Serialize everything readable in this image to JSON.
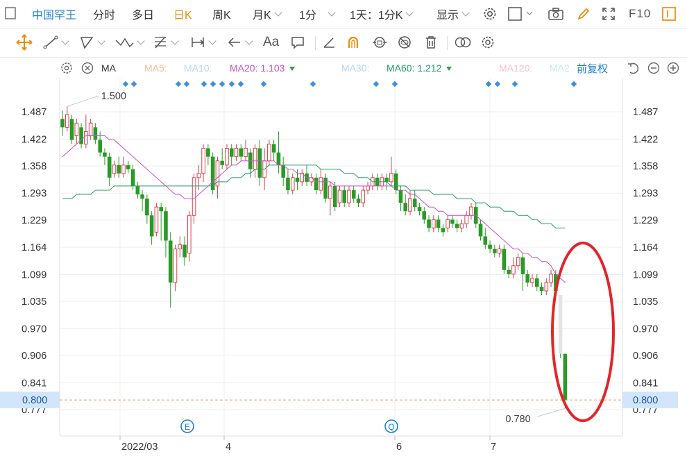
{
  "topbar": {
    "stock_name": "中国罕王",
    "tabs": [
      "分时",
      "多日",
      "日K",
      "周K",
      "月K"
    ],
    "active_tab": "日K",
    "period_select": "1分",
    "range_select": "1天：1分K",
    "display_select": "显示",
    "f10_label": "F10"
  },
  "toolbar": {
    "text_tool_label": "Aa"
  },
  "ma_bar": {
    "indicator": "MA",
    "ma5_label": "MA5:",
    "ma10_label": "MA10:",
    "ma20_label": "MA20:",
    "ma20_value": "1.103",
    "ma30_label": "MA30:",
    "ma60_label": "MA60:",
    "ma60_value": "1.212",
    "ma120_label": "MA120:",
    "ma250_label": "MA2",
    "adjust_label": "前复权"
  },
  "colors": {
    "up": "#d6404a",
    "down": "#2a9a26",
    "ma20": "#c94fc6",
    "ma60": "#219b6a",
    "accent_blue": "#1e7fd6",
    "active_orange": "#f08c00",
    "annotation_red": "#e0262b"
  },
  "chart_data": {
    "type": "candlestick",
    "y_ticks": [
      "1.487",
      "1.422",
      "1.358",
      "1.293",
      "1.229",
      "1.164",
      "1.099",
      "1.035",
      "0.970",
      "0.906",
      "0.841",
      "0.777"
    ],
    "ylim": [
      0.777,
      1.487
    ],
    "current_price": "0.800",
    "max_label": "1.500",
    "min_label": "0.780",
    "x_labels": [
      "2022/03",
      "4",
      "6",
      "7"
    ],
    "event_markers": [
      "E",
      "Q"
    ],
    "candles": [
      [
        1.47,
        1.45,
        1.49,
        1.43
      ],
      [
        1.45,
        1.48,
        1.5,
        1.44
      ],
      [
        1.47,
        1.42,
        1.48,
        1.41
      ],
      [
        1.43,
        1.46,
        1.47,
        1.41
      ],
      [
        1.45,
        1.41,
        1.46,
        1.4
      ],
      [
        1.41,
        1.44,
        1.48,
        1.4
      ],
      [
        1.43,
        1.46,
        1.47,
        1.42
      ],
      [
        1.45,
        1.42,
        1.46,
        1.41
      ],
      [
        1.42,
        1.39,
        1.44,
        1.38
      ],
      [
        1.39,
        1.38,
        1.4,
        1.36
      ],
      [
        1.38,
        1.33,
        1.39,
        1.31
      ],
      [
        1.34,
        1.36,
        1.37,
        1.33
      ],
      [
        1.36,
        1.34,
        1.38,
        1.33
      ],
      [
        1.34,
        1.36,
        1.38,
        1.33
      ],
      [
        1.36,
        1.35,
        1.37,
        1.34
      ],
      [
        1.35,
        1.31,
        1.36,
        1.3
      ],
      [
        1.31,
        1.29,
        1.32,
        1.28
      ],
      [
        1.29,
        1.28,
        1.3,
        1.25
      ],
      [
        1.28,
        1.24,
        1.29,
        1.22
      ],
      [
        1.24,
        1.19,
        1.25,
        1.17
      ],
      [
        1.2,
        1.26,
        1.27,
        1.19
      ],
      [
        1.26,
        1.25,
        1.27,
        1.18
      ],
      [
        1.25,
        1.18,
        1.26,
        1.14
      ],
      [
        1.18,
        1.08,
        1.2,
        1.02
      ],
      [
        1.08,
        1.16,
        1.17,
        1.06
      ],
      [
        1.16,
        1.17,
        1.19,
        1.14
      ],
      [
        1.17,
        1.14,
        1.19,
        1.12
      ],
      [
        1.15,
        1.24,
        1.25,
        1.13
      ],
      [
        1.24,
        1.33,
        1.34,
        1.22
      ],
      [
        1.33,
        1.34,
        1.36,
        1.3
      ],
      [
        1.34,
        1.4,
        1.41,
        1.32
      ],
      [
        1.4,
        1.38,
        1.41,
        1.36
      ],
      [
        1.38,
        1.3,
        1.39,
        1.29
      ],
      [
        1.31,
        1.37,
        1.38,
        1.28
      ],
      [
        1.37,
        1.36,
        1.4,
        1.35
      ],
      [
        1.36,
        1.4,
        1.41,
        1.35
      ],
      [
        1.4,
        1.38,
        1.41,
        1.36
      ],
      [
        1.38,
        1.4,
        1.41,
        1.37
      ],
      [
        1.4,
        1.38,
        1.41,
        1.37
      ],
      [
        1.38,
        1.4,
        1.42,
        1.37
      ],
      [
        1.39,
        1.35,
        1.4,
        1.33
      ],
      [
        1.35,
        1.4,
        1.41,
        1.33
      ],
      [
        1.4,
        1.33,
        1.42,
        1.31
      ],
      [
        1.33,
        1.37,
        1.4,
        1.3
      ],
      [
        1.37,
        1.41,
        1.42,
        1.36
      ],
      [
        1.41,
        1.39,
        1.42,
        1.37
      ],
      [
        1.39,
        1.36,
        1.44,
        1.34
      ],
      [
        1.36,
        1.33,
        1.38,
        1.31
      ],
      [
        1.33,
        1.3,
        1.35,
        1.29
      ],
      [
        1.3,
        1.33,
        1.34,
        1.29
      ],
      [
        1.33,
        1.32,
        1.35,
        1.3
      ],
      [
        1.32,
        1.34,
        1.35,
        1.31
      ],
      [
        1.34,
        1.32,
        1.36,
        1.31
      ],
      [
        1.32,
        1.33,
        1.34,
        1.31
      ],
      [
        1.33,
        1.3,
        1.34,
        1.29
      ],
      [
        1.3,
        1.33,
        1.35,
        1.29
      ],
      [
        1.33,
        1.28,
        1.34,
        1.27
      ],
      [
        1.28,
        1.31,
        1.32,
        1.24
      ],
      [
        1.31,
        1.26,
        1.32,
        1.25
      ],
      [
        1.27,
        1.3,
        1.31,
        1.26
      ],
      [
        1.3,
        1.27,
        1.31,
        1.26
      ],
      [
        1.27,
        1.3,
        1.31,
        1.26
      ],
      [
        1.3,
        1.28,
        1.31,
        1.27
      ],
      [
        1.28,
        1.27,
        1.29,
        1.26
      ],
      [
        1.27,
        1.3,
        1.31,
        1.26
      ],
      [
        1.3,
        1.31,
        1.32,
        1.29
      ],
      [
        1.31,
        1.33,
        1.34,
        1.3
      ],
      [
        1.33,
        1.31,
        1.34,
        1.3
      ],
      [
        1.31,
        1.33,
        1.34,
        1.3
      ],
      [
        1.33,
        1.32,
        1.34,
        1.3
      ],
      [
        1.32,
        1.34,
        1.38,
        1.31
      ],
      [
        1.34,
        1.3,
        1.35,
        1.29
      ],
      [
        1.3,
        1.27,
        1.31,
        1.25
      ],
      [
        1.27,
        1.25,
        1.29,
        1.24
      ],
      [
        1.25,
        1.28,
        1.3,
        1.24
      ],
      [
        1.28,
        1.26,
        1.3,
        1.25
      ],
      [
        1.26,
        1.25,
        1.27,
        1.24
      ],
      [
        1.25,
        1.23,
        1.26,
        1.22
      ],
      [
        1.23,
        1.21,
        1.24,
        1.2
      ],
      [
        1.21,
        1.23,
        1.24,
        1.2
      ],
      [
        1.23,
        1.21,
        1.24,
        1.2
      ],
      [
        1.21,
        1.2,
        1.22,
        1.19
      ],
      [
        1.21,
        1.23,
        1.24,
        1.2
      ],
      [
        1.23,
        1.22,
        1.24,
        1.21
      ],
      [
        1.22,
        1.21,
        1.23,
        1.2
      ],
      [
        1.21,
        1.22,
        1.23,
        1.2
      ],
      [
        1.22,
        1.24,
        1.25,
        1.21
      ],
      [
        1.24,
        1.26,
        1.27,
        1.23
      ],
      [
        1.26,
        1.22,
        1.27,
        1.21
      ],
      [
        1.22,
        1.19,
        1.23,
        1.18
      ],
      [
        1.19,
        1.17,
        1.21,
        1.16
      ],
      [
        1.17,
        1.16,
        1.18,
        1.15
      ],
      [
        1.16,
        1.15,
        1.17,
        1.14
      ],
      [
        1.15,
        1.16,
        1.17,
        1.14
      ],
      [
        1.16,
        1.11,
        1.17,
        1.1
      ],
      [
        1.11,
        1.1,
        1.12,
        1.09
      ],
      [
        1.1,
        1.12,
        1.14,
        1.09
      ],
      [
        1.12,
        1.14,
        1.15,
        1.11
      ],
      [
        1.14,
        1.1,
        1.15,
        1.06
      ],
      [
        1.1,
        1.08,
        1.11,
        1.07
      ],
      [
        1.08,
        1.09,
        1.1,
        1.07
      ],
      [
        1.09,
        1.07,
        1.1,
        1.06
      ],
      [
        1.07,
        1.06,
        1.08,
        1.05
      ],
      [
        1.06,
        1.08,
        1.09,
        1.05
      ],
      [
        1.08,
        1.1,
        1.11,
        1.07
      ],
      [
        1.1,
        1.06,
        1.11,
        1.04
      ],
      [
        1.05,
        0.91,
        1.05,
        0.9
      ],
      [
        0.91,
        0.8,
        0.91,
        0.78
      ]
    ],
    "ma20": [
      1.38,
      1.39,
      1.4,
      1.41,
      1.42,
      1.43,
      1.43,
      1.43,
      1.43,
      1.43,
      1.42,
      1.42,
      1.41,
      1.4,
      1.39,
      1.38,
      1.37,
      1.36,
      1.35,
      1.34,
      1.33,
      1.32,
      1.31,
      1.3,
      1.29,
      1.29,
      1.28,
      1.28,
      1.28,
      1.29,
      1.3,
      1.31,
      1.32,
      1.33,
      1.34,
      1.35,
      1.36,
      1.36,
      1.37,
      1.37,
      1.37,
      1.37,
      1.37,
      1.37,
      1.37,
      1.37,
      1.36,
      1.36,
      1.35,
      1.35,
      1.34,
      1.34,
      1.33,
      1.33,
      1.32,
      1.32,
      1.32,
      1.32,
      1.31,
      1.31,
      1.31,
      1.31,
      1.31,
      1.31,
      1.31,
      1.31,
      1.31,
      1.31,
      1.31,
      1.31,
      1.31,
      1.3,
      1.3,
      1.3,
      1.29,
      1.29,
      1.28,
      1.27,
      1.26,
      1.26,
      1.25,
      1.25,
      1.24,
      1.24,
      1.24,
      1.24,
      1.24,
      1.24,
      1.24,
      1.23,
      1.22,
      1.21,
      1.2,
      1.19,
      1.18,
      1.17,
      1.16,
      1.16,
      1.15,
      1.15,
      1.14,
      1.14,
      1.13,
      1.13,
      1.12,
      1.1,
      1.09,
      1.08
    ],
    "ma60": [
      1.28,
      1.28,
      1.28,
      1.29,
      1.29,
      1.29,
      1.29,
      1.3,
      1.3,
      1.3,
      1.3,
      1.31,
      1.31,
      1.31,
      1.31,
      1.31,
      1.31,
      1.31,
      1.31,
      1.31,
      1.31,
      1.31,
      1.31,
      1.31,
      1.31,
      1.31,
      1.31,
      1.31,
      1.31,
      1.31,
      1.31,
      1.31,
      1.31,
      1.32,
      1.32,
      1.32,
      1.33,
      1.33,
      1.33,
      1.34,
      1.34,
      1.35,
      1.35,
      1.35,
      1.36,
      1.36,
      1.36,
      1.36,
      1.36,
      1.36,
      1.36,
      1.36,
      1.36,
      1.36,
      1.36,
      1.35,
      1.35,
      1.35,
      1.35,
      1.35,
      1.34,
      1.34,
      1.34,
      1.33,
      1.33,
      1.33,
      1.32,
      1.32,
      1.32,
      1.32,
      1.31,
      1.31,
      1.31,
      1.31,
      1.3,
      1.3,
      1.3,
      1.3,
      1.3,
      1.29,
      1.29,
      1.29,
      1.29,
      1.29,
      1.28,
      1.28,
      1.28,
      1.28,
      1.27,
      1.27,
      1.27,
      1.26,
      1.26,
      1.26,
      1.25,
      1.25,
      1.25,
      1.24,
      1.24,
      1.24,
      1.23,
      1.23,
      1.22,
      1.22,
      1.22,
      1.21,
      1.21,
      1.21
    ]
  }
}
